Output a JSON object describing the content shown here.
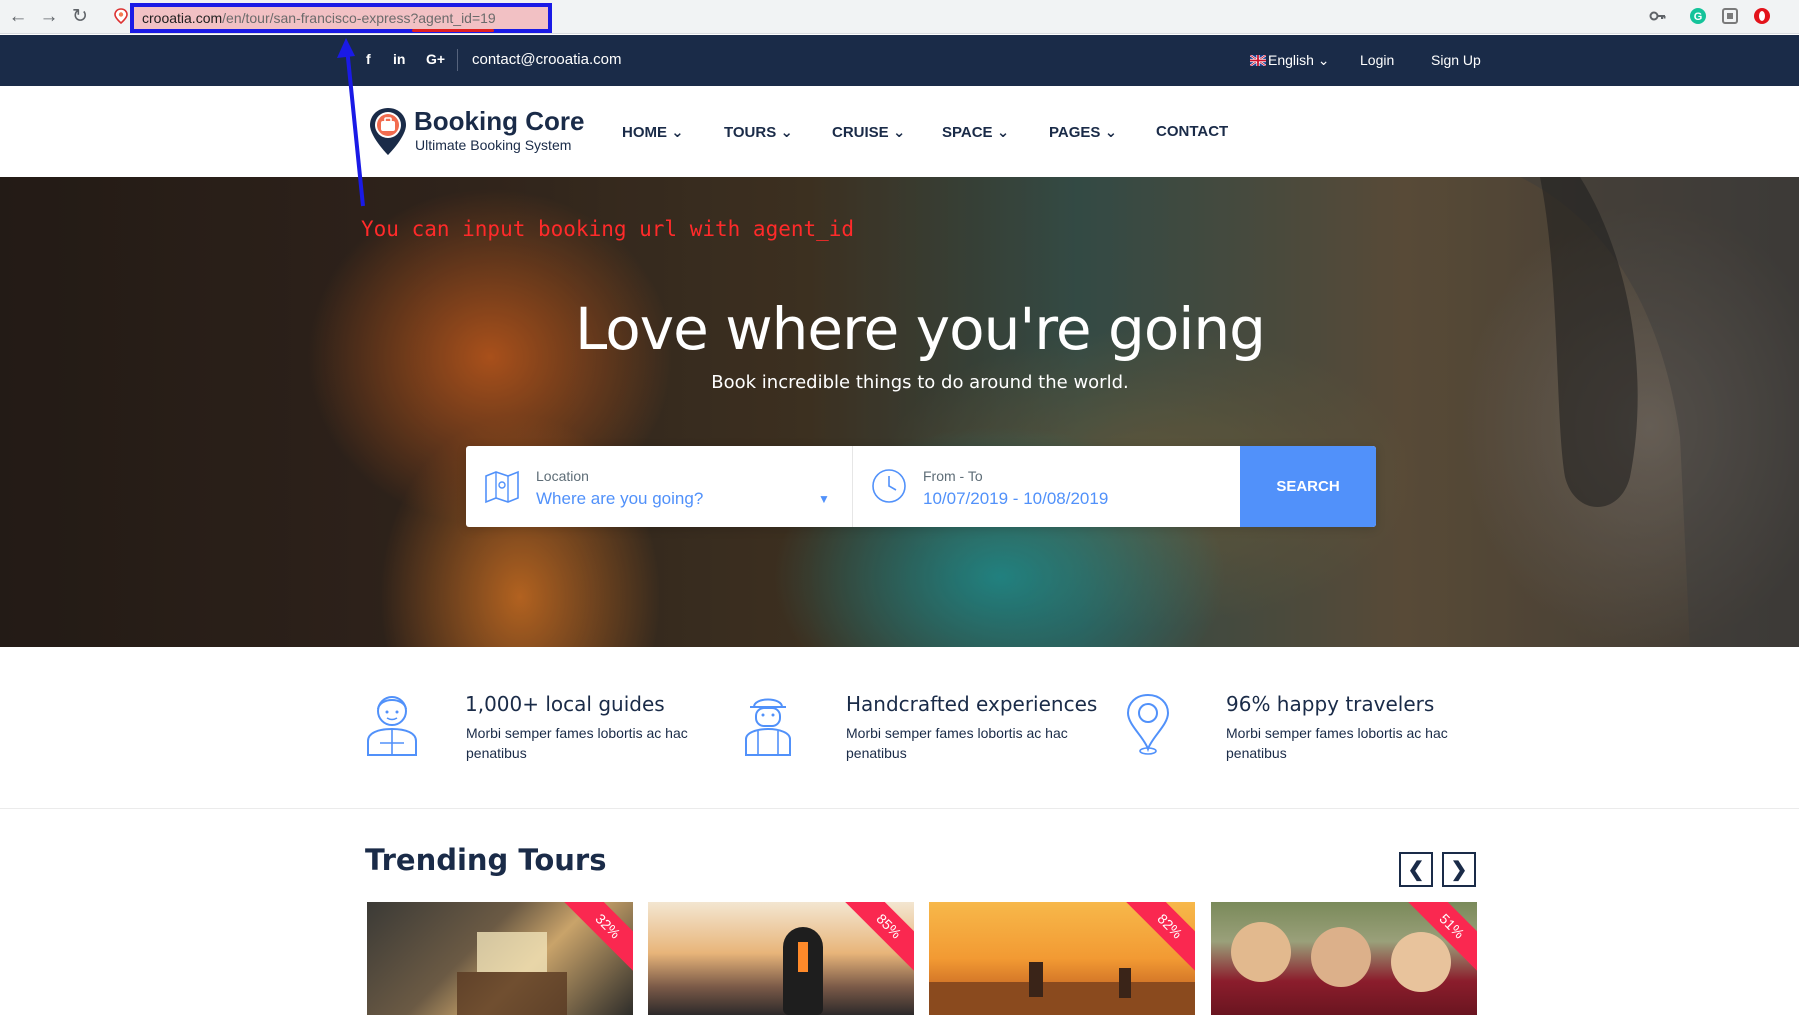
{
  "browser": {
    "url_domain": "crooatia.com",
    "url_path": "/en/tour/san-francisco-express?agent_id=19"
  },
  "topbar": {
    "social": [
      "f",
      "in",
      "G+"
    ],
    "email": "contact@crooatia.com",
    "language": "English",
    "login": "Login",
    "signup": "Sign Up"
  },
  "logo": {
    "title": "Booking Core",
    "subtitle": "Ultimate Booking System"
  },
  "menu": [
    "HOME",
    "TOURS",
    "CRUISE",
    "SPACE",
    "PAGES",
    "CONTACT"
  ],
  "annotation": "You can input booking url with agent_id",
  "hero": {
    "title": "Love where you're going",
    "subtitle": "Book incredible things to do around the world."
  },
  "search": {
    "location_label": "Location",
    "location_placeholder": "Where are you going?",
    "date_label": "From - To",
    "date_value": "10/07/2019 - 10/08/2019",
    "button": "SEARCH"
  },
  "features": [
    {
      "title": "1,000+ local guides",
      "desc": "Morbi semper fames lobortis ac hac penatibus",
      "icon": "guide-icon"
    },
    {
      "title": "Handcrafted experiences",
      "desc": "Morbi semper fames lobortis ac hac penatibus",
      "icon": "traveler-icon"
    },
    {
      "title": "96% happy travelers",
      "desc": "Morbi semper fames lobortis ac hac penatibus",
      "icon": "location-pin-icon"
    }
  ],
  "trending": {
    "title": "Trending Tours",
    "prev": "❮",
    "next": "❯",
    "tours": [
      {
        "discount": "32%"
      },
      {
        "discount": "85%"
      },
      {
        "discount": "82%"
      },
      {
        "discount": "51%"
      }
    ]
  },
  "colors": {
    "navy": "#1a2b48",
    "accent": "#5191fa",
    "ribbon": "#fa2850",
    "annotation": "#ff2a2a",
    "highlight_border": "#1a1ae6"
  }
}
